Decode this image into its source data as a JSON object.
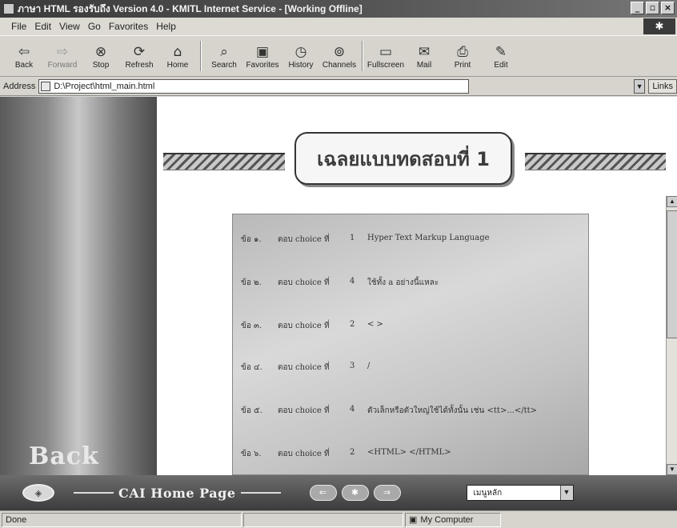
{
  "window": {
    "title": "ภาษา HTML รองรับถึง Version 4.0 - KMITL Internet Service - [Working Offline]",
    "controls": [
      "_",
      "▫",
      "×"
    ]
  },
  "menu": [
    "File",
    "Edit",
    "View",
    "Go",
    "Favorites",
    "Help"
  ],
  "toolbar": [
    {
      "label": "Back",
      "icon": "back-arrow-icon"
    },
    {
      "label": "Forward",
      "icon": "forward-arrow-icon"
    },
    {
      "label": "Stop",
      "icon": "stop-icon"
    },
    {
      "label": "Refresh",
      "icon": "refresh-icon"
    },
    {
      "label": "Home",
      "icon": "home-icon"
    },
    {
      "label": "Search",
      "icon": "search-icon"
    },
    {
      "label": "Favorites",
      "icon": "favorites-icon"
    },
    {
      "label": "History",
      "icon": "history-icon"
    },
    {
      "label": "Channels",
      "icon": "channels-icon"
    },
    {
      "label": "Fullscreen",
      "icon": "fullscreen-icon"
    },
    {
      "label": "Mail",
      "icon": "mail-icon"
    },
    {
      "label": "Print",
      "icon": "print-icon"
    },
    {
      "label": "Edit",
      "icon": "edit-icon"
    }
  ],
  "address": {
    "label": "Address",
    "value": "D:\\Project\\html_main.html",
    "links_label": "Links"
  },
  "content": {
    "banner_title": "เฉลยแบบทดสอบที่ 1",
    "answers": [
      {
        "q": "ข้อ ๑.",
        "label": "ตอบ choice ที่",
        "num": "1",
        "text": "Hyper Text Markup Language"
      },
      {
        "q": "ข้อ ๒.",
        "label": "ตอบ choice ที่",
        "num": "4",
        "text": "ใช้ทั้ง a อย่างนี้แหละ"
      },
      {
        "q": "ข้อ ๓.",
        "label": "ตอบ choice ที่",
        "num": "2",
        "text": "< >"
      },
      {
        "q": "ข้อ ๔.",
        "label": "ตอบ choice ที่",
        "num": "3",
        "text": "/"
      },
      {
        "q": "ข้อ ๕.",
        "label": "ตอบ choice ที่",
        "num": "4",
        "text": "ตัวเล็กหรือตัวใหญ่ใช้ได้ทั้งนั้น เช่น <tt>...</tt>"
      },
      {
        "q": "ข้อ ๖.",
        "label": "ตอบ choice ที่",
        "num": "2",
        "text": "<HTML> </HTML>"
      }
    ],
    "back_text": "Back"
  },
  "navbar": {
    "title": "CAI Home Page",
    "menu_select": "เมนูหลัก"
  },
  "status": {
    "text": "Done",
    "zone": "My Computer"
  }
}
